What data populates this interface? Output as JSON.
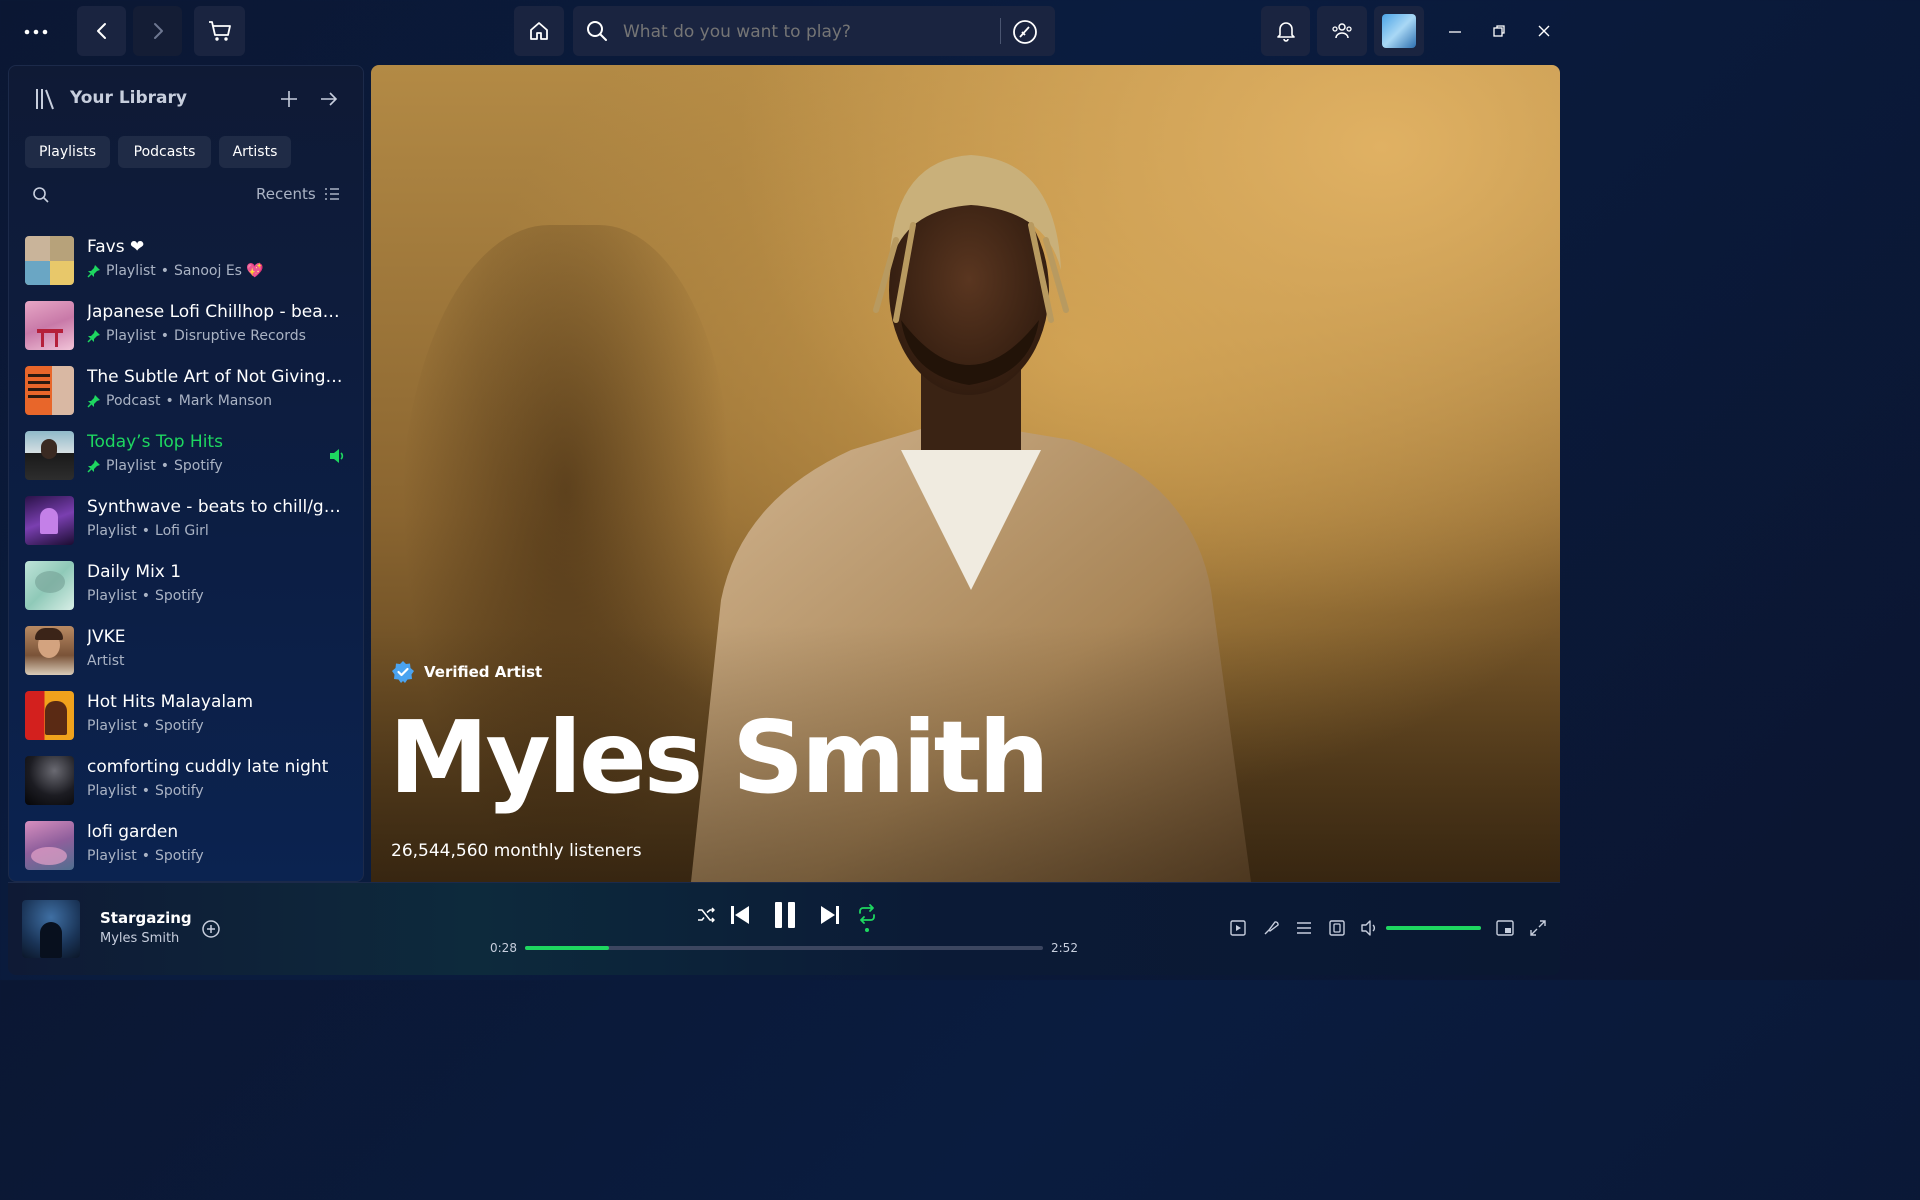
{
  "topbar": {
    "search_placeholder": "What do you want to play?"
  },
  "library": {
    "title": "Your Library",
    "filters": [
      "Playlists",
      "Podcasts",
      "Artists"
    ],
    "sort_label": "Recents",
    "items": [
      {
        "title": "Favs ❤",
        "type": "Playlist",
        "owner": "Sanooj Es 💖",
        "pinned": true,
        "playing": false
      },
      {
        "title": "Japanese Lofi Chillhop - bea…",
        "type": "Playlist",
        "owner": "Disruptive Records",
        "pinned": true,
        "playing": false
      },
      {
        "title": "The Subtle Art of Not Giving a…",
        "type": "Podcast",
        "owner": "Mark Manson",
        "pinned": true,
        "playing": false
      },
      {
        "title": "Today’s Top Hits",
        "type": "Playlist",
        "owner": "Spotify",
        "pinned": true,
        "playing": true
      },
      {
        "title": "Synthwave - beats to chill/g…",
        "type": "Playlist",
        "owner": "Lofi Girl",
        "pinned": false,
        "playing": false
      },
      {
        "title": "Daily Mix 1",
        "type": "Playlist",
        "owner": "Spotify",
        "pinned": false,
        "playing": false
      },
      {
        "title": "JVKE",
        "type": "Artist",
        "owner": "",
        "pinned": false,
        "playing": false
      },
      {
        "title": "Hot Hits Malayalam",
        "type": "Playlist",
        "owner": "Spotify",
        "pinned": false,
        "playing": false
      },
      {
        "title": "comforting cuddly late night",
        "type": "Playlist",
        "owner": "Spotify",
        "pinned": false,
        "playing": false
      },
      {
        "title": "lofi garden",
        "type": "Playlist",
        "owner": "Spotify",
        "pinned": false,
        "playing": false
      }
    ]
  },
  "artist": {
    "verified_label": "Verified Artist",
    "name": "Myles Smith",
    "listeners": "26,544,560 monthly listeners"
  },
  "player": {
    "track_title": "Stargazing",
    "track_artist": "Myles Smith",
    "elapsed": "0:28",
    "duration": "2:52",
    "progress": 0.163,
    "volume": 1.0,
    "accent_color": "#1ed760"
  }
}
